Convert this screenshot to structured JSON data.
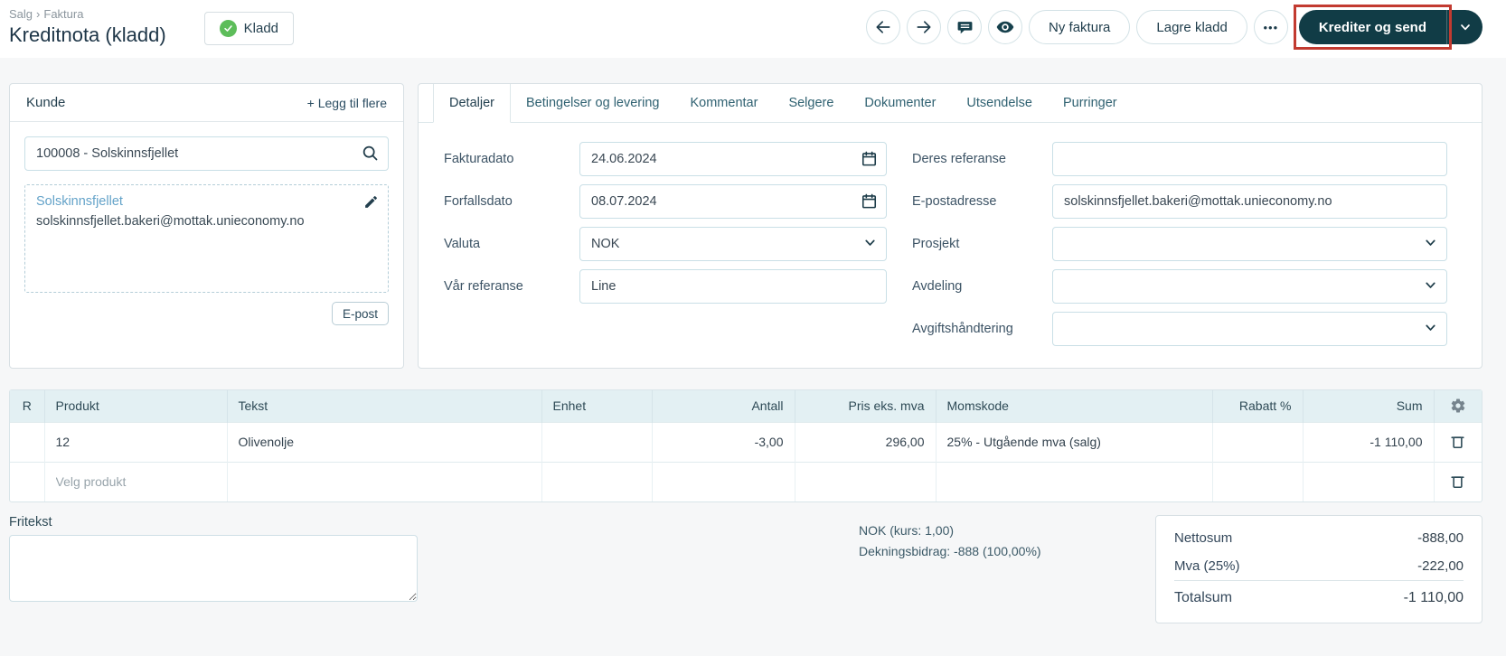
{
  "colors": {
    "accent_dark": "#113c46",
    "annotation_red": "#c23a30",
    "badge_green": "#5dbd5a",
    "link_blue": "#64a3c9",
    "table_header_bg": "#e3f0f3"
  },
  "breadcrumb": {
    "section": "Salg",
    "separator": "›",
    "page": "Faktura"
  },
  "header": {
    "title": "Kreditnota (kladd)",
    "status_badge": "Kladd"
  },
  "icons": {
    "more_options": "•••"
  },
  "toolbar": {
    "new_invoice": "Ny faktura",
    "save_draft": "Lagre kladd",
    "primary_action": "Krediter og send"
  },
  "customer_panel": {
    "title": "Kunde",
    "add_more": "+ Legg til flere",
    "search_value": "100008 - Solskinnsfjellet",
    "name": "Solskinnsfjellet",
    "email": "solskinnsfjellet.bakeri@mottak.unieconomy.no",
    "email_button": "E-post"
  },
  "details_panel": {
    "tabs": [
      {
        "label": "Detaljer"
      },
      {
        "label": "Betingelser og levering"
      },
      {
        "label": "Kommentar"
      },
      {
        "label": "Selgere"
      },
      {
        "label": "Dokumenter"
      },
      {
        "label": "Utsendelse"
      },
      {
        "label": "Purringer"
      }
    ],
    "fakturadato": {
      "label": "Fakturadato",
      "value": "24.06.2024"
    },
    "forfallsdato": {
      "label": "Forfallsdato",
      "value": "08.07.2024"
    },
    "valuta": {
      "label": "Valuta",
      "value": "NOK"
    },
    "var_referanse": {
      "label": "Vår referanse",
      "value": "Line"
    },
    "deres_referanse": {
      "label": "Deres referanse",
      "value": ""
    },
    "epostadresse": {
      "label": "E-postadresse",
      "value": "solskinnsfjellet.bakeri@mottak.unieconomy.no"
    },
    "prosjekt": {
      "label": "Prosjekt",
      "value": ""
    },
    "avdeling": {
      "label": "Avdeling",
      "value": ""
    },
    "avgiftshandtering": {
      "label": "Avgiftshåndtering",
      "value": ""
    }
  },
  "table": {
    "headers": [
      "R",
      "Produkt",
      "Tekst",
      "Enhet",
      "Antall",
      "Pris eks. mva",
      "Momskode",
      "Rabatt %",
      "Sum"
    ],
    "rows": [
      {
        "r": "",
        "produkt": "12",
        "tekst": "Olivenolje",
        "enhet": "",
        "antall": "-3,00",
        "pris": "296,00",
        "momskode": "25% - Utgående mva (salg)",
        "rabatt": "",
        "sum": "-1 110,00"
      }
    ],
    "new_row_placeholder": "Velg produkt"
  },
  "footer": {
    "fritekst_label": "Fritekst",
    "currency_info": "NOK (kurs: 1,00)",
    "contribution_info": "Dekningsbidrag: -888 (100,00%)",
    "totals": [
      {
        "label": "Nettosum",
        "value": "-888,00"
      },
      {
        "label": "Mva (25%)",
        "value": "-222,00"
      },
      {
        "label": "Totalsum",
        "value": "-1 110,00"
      }
    ]
  }
}
